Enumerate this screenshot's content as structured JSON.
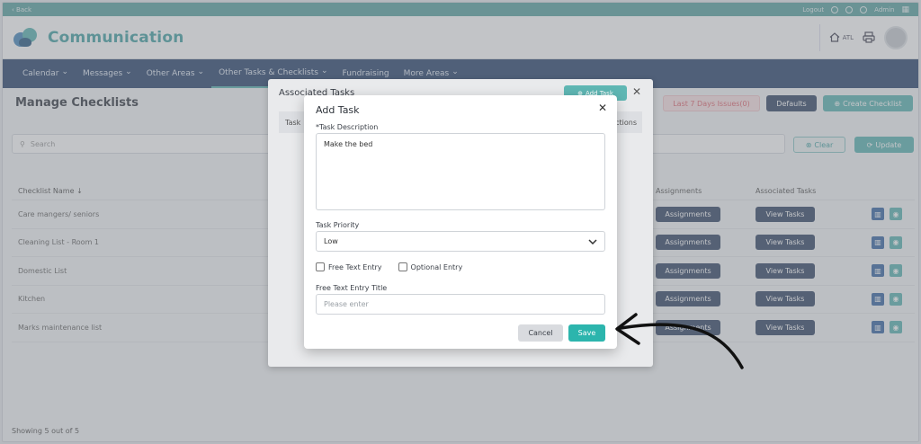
{
  "topbar": {
    "back": "‹ Back",
    "logout": "Logout",
    "user": "Admin"
  },
  "header": {
    "app_title": "Communication",
    "location": "ATL"
  },
  "nav": [
    {
      "label": "Calendar",
      "dropdown": true
    },
    {
      "label": "Messages",
      "dropdown": true
    },
    {
      "label": "Other Areas",
      "dropdown": true
    },
    {
      "label": "Other Tasks & Checklists",
      "dropdown": true,
      "active": true
    },
    {
      "label": "Fundraising",
      "dropdown": false
    },
    {
      "label": "More Areas",
      "dropdown": true
    }
  ],
  "page": {
    "title": "Manage Checklists",
    "issues_button": "Last 7 Days Issues(0)",
    "defaults_button": "Defaults",
    "create_button": "Create Checklist",
    "search_placeholder": "Search",
    "clear_button": "Clear",
    "update_button": "Update",
    "showing": "Showing 5 out of 5"
  },
  "table": {
    "headers": {
      "name": "Checklist Name",
      "assignments": "Assignments",
      "tasks": "Associated Tasks"
    },
    "rows": [
      {
        "name": "Care mangers/ seniors",
        "assign": "Assignments",
        "view": "View Tasks"
      },
      {
        "name": "Cleaning List - Room 1",
        "assign": "Assignments",
        "view": "View Tasks"
      },
      {
        "name": "Domestic List",
        "assign": "Assignments",
        "view": "View Tasks"
      },
      {
        "name": "Kitchen",
        "assign": "Assignments",
        "view": "View Tasks"
      },
      {
        "name": "Marks maintenance list",
        "assign": "Assignments",
        "view": "View Tasks"
      }
    ]
  },
  "assoc_modal": {
    "title": "Associated Tasks",
    "add_button": "Add Task",
    "col_task": "Task",
    "col_actions": "Actions"
  },
  "dialog": {
    "title": "Add Task",
    "description_label": "*Task Description",
    "description_value": "Make the bed",
    "priority_label": "Task Priority",
    "priority_value": "Low",
    "free_text_entry": "Free Text Entry",
    "optional_entry": "Optional Entry",
    "free_text_title_label": "Free Text Entry Title",
    "free_text_title_placeholder": "Please enter",
    "cancel": "Cancel",
    "save": "Save"
  },
  "colors": {
    "teal": "#5fb7b4",
    "navy": "#304a72",
    "save": "#2cb5ad"
  }
}
